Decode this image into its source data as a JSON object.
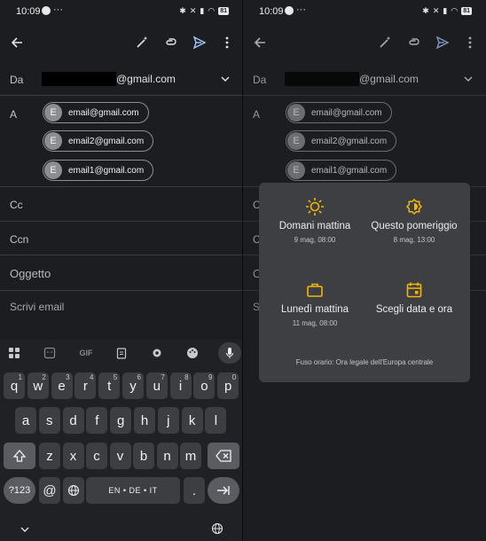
{
  "status": {
    "time": "10:09",
    "dots": "···",
    "battery": "81"
  },
  "compose": {
    "from_label": "Da",
    "from_domain": "@gmail.com",
    "to_label": "A",
    "recipients": [
      {
        "initial": "E",
        "email": "email@gmail.com"
      },
      {
        "initial": "E",
        "email": "email2@gmail.com"
      },
      {
        "initial": "E",
        "email": "email1@gmail.com"
      }
    ],
    "cc_label": "Cc",
    "bcc_label": "Ccn",
    "subject_placeholder": "Oggetto",
    "body_placeholder": "Scrivi email"
  },
  "keyboard": {
    "gif_label": "GIF",
    "row1": [
      {
        "k": "q",
        "s": "1"
      },
      {
        "k": "w",
        "s": "2"
      },
      {
        "k": "e",
        "s": "3"
      },
      {
        "k": "r",
        "s": "4"
      },
      {
        "k": "t",
        "s": "5"
      },
      {
        "k": "y",
        "s": "6"
      },
      {
        "k": "u",
        "s": "7"
      },
      {
        "k": "i",
        "s": "8"
      },
      {
        "k": "o",
        "s": "9"
      },
      {
        "k": "p",
        "s": "0"
      }
    ],
    "row2": [
      "a",
      "s",
      "d",
      "f",
      "g",
      "h",
      "j",
      "k",
      "l"
    ],
    "row3": [
      "z",
      "x",
      "c",
      "v",
      "b",
      "n",
      "m"
    ],
    "symbols_label": "?123",
    "at_label": "@",
    "comma_label": ",",
    "space_label": "EN • DE • IT",
    "period_label": "."
  },
  "schedule": {
    "options": [
      {
        "title": "Domani mattina",
        "sub": "9 mag, 08:00",
        "icon": "sun-icon"
      },
      {
        "title": "Questo pomeriggio",
        "sub": "8 mag, 13:00",
        "icon": "half-sun-icon"
      },
      {
        "title": "Lunedì mattina",
        "sub": "11 mag, 08:00",
        "icon": "briefcase-icon"
      },
      {
        "title": "Scegli data e ora",
        "sub": "",
        "icon": "calendar-icon"
      }
    ],
    "timezone": "Fuso orario: Ora legale dell'Europa centrale"
  },
  "colors": {
    "send_accent": "#a8c7fa",
    "chip_avatar": "#8c8d91",
    "popup_bg": "#3d3f43",
    "keyboard_accent": "#4a5a73"
  }
}
